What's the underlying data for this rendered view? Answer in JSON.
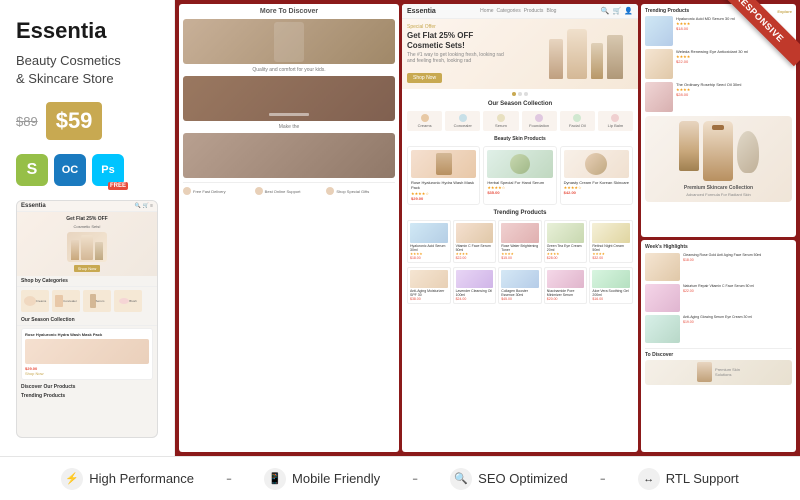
{
  "brand": {
    "name": "Essentia",
    "subtitle_line1": "Beauty Cosmetics",
    "subtitle_line2": "& Skincare Store",
    "price_original": "$89",
    "price_sale": "$59"
  },
  "icons": {
    "shopify_label": "S",
    "opencart_label": "OC",
    "ps_label": "Ps",
    "free_label": "FREE"
  },
  "ribbon": {
    "label": "RESPONSIVE"
  },
  "bottom_features": [
    {
      "label": "High Performance",
      "icon": "⚡"
    },
    {
      "label": "Mobile Friendly",
      "icon": "📱"
    },
    {
      "label": "SEO Optimized",
      "icon": "🔍"
    },
    {
      "label": "RTL Support",
      "icon": "↔"
    }
  ],
  "separator": "-",
  "screenshot": {
    "hero_title": "Get Flat 25% OFF",
    "hero_subtitle": "Cosmetic Sets!",
    "special_offer_label": "Special Offer",
    "shop_now": "Shop Now",
    "categories_title": "Our Season Collection",
    "categories": [
      {
        "label": "Creams"
      },
      {
        "label": "Concealer"
      },
      {
        "label": "Serum"
      },
      {
        "label": "Foundation"
      },
      {
        "label": "Facial Oil"
      },
      {
        "label": "Lip Balm"
      }
    ],
    "trending_title": "Trending Products",
    "products": [
      {
        "name": "Rose Hyaluronic Hydra Wash Mask Pack",
        "price": "$29.00",
        "stars": "★★★★"
      },
      {
        "name": "Herbal Special For Hand Serum",
        "price": "$35.00",
        "stars": "★★★★"
      },
      {
        "name": "Dynasty Cream For Korean Skincare",
        "price": "$42.00",
        "stars": "★★★★"
      }
    ],
    "more_to_discover": "More To Discover",
    "quality_label": "Quality and comfort for your kids.",
    "make_label": "Make the",
    "footer_items": [
      {
        "label": "Free Fast Delivery"
      },
      {
        "label": "Best Online Support"
      },
      {
        "label": "Shop Special Gifts"
      }
    ],
    "week_highlights_title": "Week's Highlights",
    "week_products": [
      {
        "name": "Cleansing Rose Gold Anti Aging Face Serum 50ml",
        "price": "$18.00"
      },
      {
        "name": "Naturium Repair Vitamin C Face Serum 50 ml",
        "price": "$22.00"
      },
      {
        "name": "Anti-Aging Glowing Serum Eye Cream 30 ml",
        "price": "$19.00"
      }
    ]
  }
}
